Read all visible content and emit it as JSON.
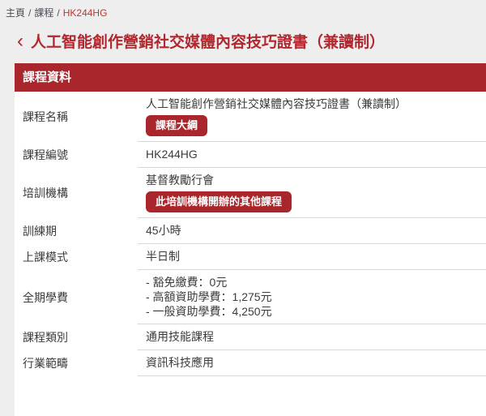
{
  "breadcrumb": {
    "home": "主頁",
    "section": "課程",
    "current": "HK244HG",
    "separator": "/"
  },
  "page": {
    "back_chevron": "‹",
    "title": "人工智能創作營銷社交媒體內容技巧證書（兼讀制）"
  },
  "panel": {
    "header": "課程資料"
  },
  "course": {
    "rows": [
      {
        "label": "課程名稱",
        "value": "人工智能創作營銷社交媒體內容技巧證書（兼讀制）",
        "button": "課程大綱"
      },
      {
        "label": "課程編號",
        "value": "HK244HG"
      },
      {
        "label": "培訓機構",
        "value": "基督教勵行會",
        "button": "此培訓機構開辦的其他課程"
      },
      {
        "label": "訓練期",
        "value": "45小時"
      },
      {
        "label": "上課模式",
        "value": "半日制"
      },
      {
        "label": "全期學費",
        "lines": [
          "- 豁免繳費：0元",
          "- 高額資助學費：1,275元",
          "- 一般資助學費：4,250元"
        ]
      },
      {
        "label": "課程類別",
        "value": "通用技能課程"
      },
      {
        "label": "行業範疇",
        "value": "資訊科技應用"
      }
    ]
  },
  "colors": {
    "primary_red": "#a9262c",
    "title_red": "#b0282e",
    "breadcrumb_red": "#c1342e",
    "text": "#3c3c3c",
    "divider": "#d8d8d8",
    "page_bg": "#efeeef"
  }
}
